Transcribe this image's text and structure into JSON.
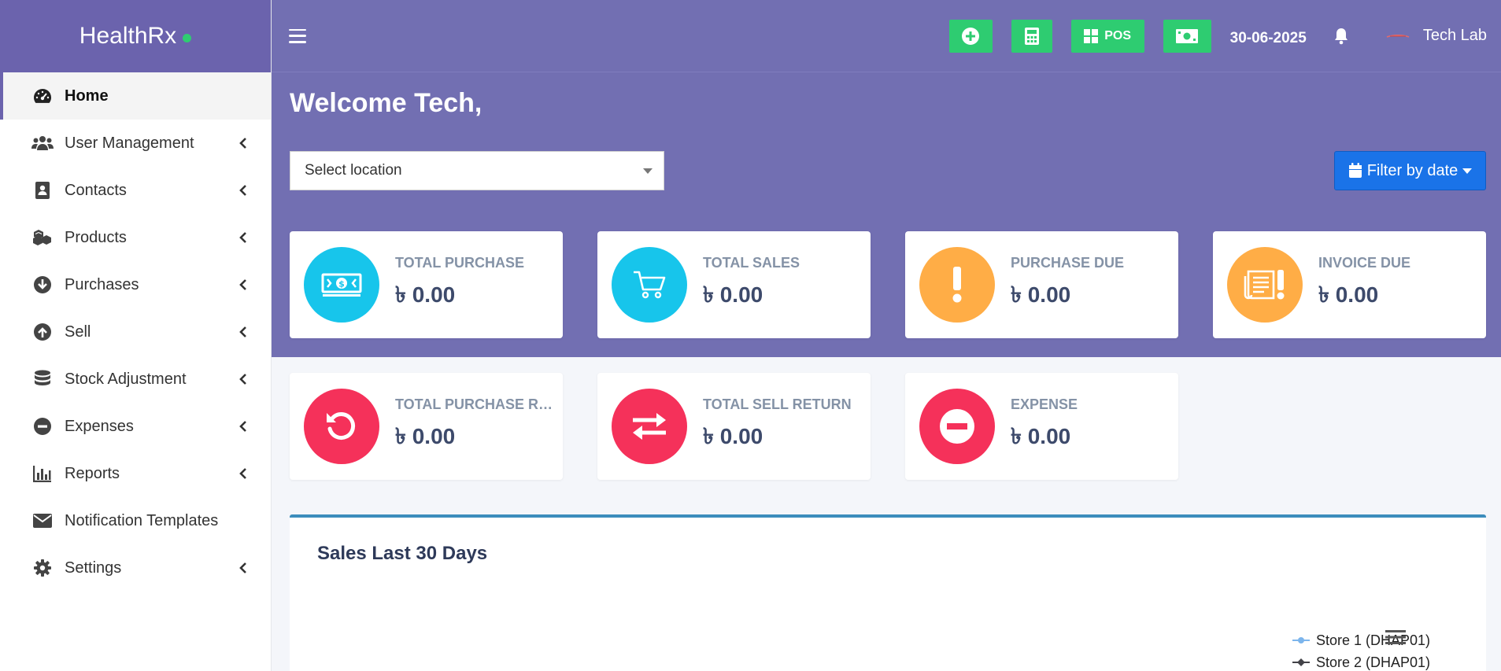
{
  "brand": {
    "name": "HealthRx",
    "status_color": "#2ecc71"
  },
  "sidebar": {
    "items": [
      {
        "label": "Home",
        "icon": "dashboard-icon",
        "active": true,
        "chevron": false
      },
      {
        "label": "User Management",
        "icon": "users-icon",
        "chevron": true
      },
      {
        "label": "Contacts",
        "icon": "address-book-icon",
        "chevron": true
      },
      {
        "label": "Products",
        "icon": "cubes-icon",
        "chevron": true
      },
      {
        "label": "Purchases",
        "icon": "arrow-circle-down-icon",
        "chevron": true
      },
      {
        "label": "Sell",
        "icon": "arrow-circle-up-icon",
        "chevron": true
      },
      {
        "label": "Stock Adjustment",
        "icon": "database-icon",
        "chevron": true
      },
      {
        "label": "Expenses",
        "icon": "minus-circle-icon",
        "chevron": true
      },
      {
        "label": "Reports",
        "icon": "bar-chart-icon",
        "chevron": true
      },
      {
        "label": "Notification Templates",
        "icon": "envelope-icon",
        "chevron": false
      },
      {
        "label": "Settings",
        "icon": "gear-icon",
        "chevron": true
      }
    ]
  },
  "topbar": {
    "pos_label": "POS",
    "date": "30-06-2025",
    "user_name": "Tech Lab",
    "accent": "#2ecc71"
  },
  "main": {
    "welcome": "Welcome Tech,",
    "location_placeholder": "Select location",
    "filter_label": "Filter by date",
    "cards": [
      {
        "title": "TOTAL PURCHASE",
        "amount": "৳ 0.00",
        "color": "#17c5eb",
        "icon": "money-icon"
      },
      {
        "title": "TOTAL SALES",
        "amount": "৳ 0.00",
        "color": "#17c5eb",
        "icon": "cart-icon"
      },
      {
        "title": "PURCHASE DUE",
        "amount": "৳ 0.00",
        "color": "#ffad46",
        "icon": "exclamation-icon"
      },
      {
        "title": "INVOICE DUE",
        "amount": "৳ 0.00",
        "color": "#ffad46",
        "icon": "invoice-alert-icon"
      },
      {
        "title": "TOTAL PURCHASE RETURN",
        "amount": "৳ 0.00",
        "color": "#f5315a",
        "icon": "undo-icon"
      },
      {
        "title": "TOTAL SELL RETURN",
        "amount": "৳ 0.00",
        "color": "#f5315a",
        "icon": "exchange-icon"
      },
      {
        "title": "EXPENSE",
        "amount": "৳ 0.00",
        "color": "#f5315a",
        "icon": "minus-circle-icon"
      }
    ],
    "sales_chart": {
      "title": "Sales Last 30 Days",
      "legend": [
        {
          "name": "Store 1 (DHAP01)",
          "color": "#7cb5ec"
        },
        {
          "name": "Store 2 (DHAP01)",
          "color": "#434348"
        }
      ]
    }
  }
}
